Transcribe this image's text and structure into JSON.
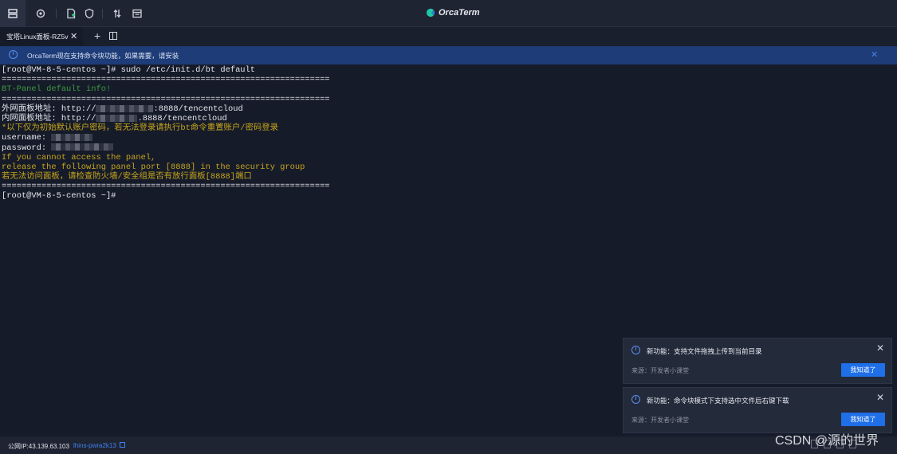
{
  "toolbar": {
    "icons": [
      "server-list-icon",
      "settings-icon",
      "new-file-icon",
      "shield-icon",
      "split-arrows-icon",
      "window-icon"
    ]
  },
  "brand": {
    "name": "OrcaTerm",
    "accent": "#1fc8a8"
  },
  "tabs": [
    {
      "label": "宝塔Linux面板-RZ5v",
      "close": "✕"
    }
  ],
  "tab_actions": {
    "add": "+"
  },
  "notice": {
    "text": "OrcaTerm现在支持命令块功能，如果需要，请安装",
    "close": "✕"
  },
  "terminal": {
    "lines": [
      {
        "text": "[root@VM-8-5-centos ~]# sudo /etc/init.d/bt default",
        "color": "white"
      },
      {
        "text": "==================================================================",
        "color": "white"
      },
      {
        "text": "BT-Panel default info!",
        "color": "green"
      },
      {
        "text": "==================================================================",
        "color": "white"
      },
      {
        "prefix": "外网面板地址: http://",
        "suffix": ":8888/tencentcloud",
        "color": "white",
        "redacted": true
      },
      {
        "prefix": "内网面板地址: http://",
        "suffix": ".8888/tencentcloud",
        "color": "white",
        "redacted": true
      },
      {
        "text": "*以下仅为初始默认账户密码，若无法登录请执行bt命令重置账户/密码登录",
        "color": "yellow"
      },
      {
        "prefix": "username: ",
        "suffix": "",
        "color": "white",
        "redacted": true
      },
      {
        "prefix": "password: ",
        "suffix": "",
        "color": "white",
        "redacted": true
      },
      {
        "text": "If you cannot access the panel,",
        "color": "yellow"
      },
      {
        "text": "release the following panel port [8888] in the security group",
        "color": "yellow"
      },
      {
        "text": "若无法访问面板，请检查防火墙/安全组是否有放行面板[8888]端口",
        "color": "yellow"
      },
      {
        "text": "==================================================================",
        "color": "white"
      },
      {
        "text": "[root@VM-8-5-centos ~]#",
        "color": "white"
      }
    ]
  },
  "toasts": [
    {
      "title": "新功能：支持文件拖拽上传到当前目录",
      "source": "来源：开发者小课堂",
      "button": "我知道了",
      "close": "✕"
    },
    {
      "title": "新功能：命令块模式下支持选中文件后右键下载",
      "source": "来源：开发者小课堂",
      "button": "我知道了",
      "close": "✕"
    }
  ],
  "statusbar": {
    "ip": "公网IP:43.139.63.103",
    "instance_id": "lhins-pwra2k13"
  },
  "watermark": "CSDN @源的世界"
}
